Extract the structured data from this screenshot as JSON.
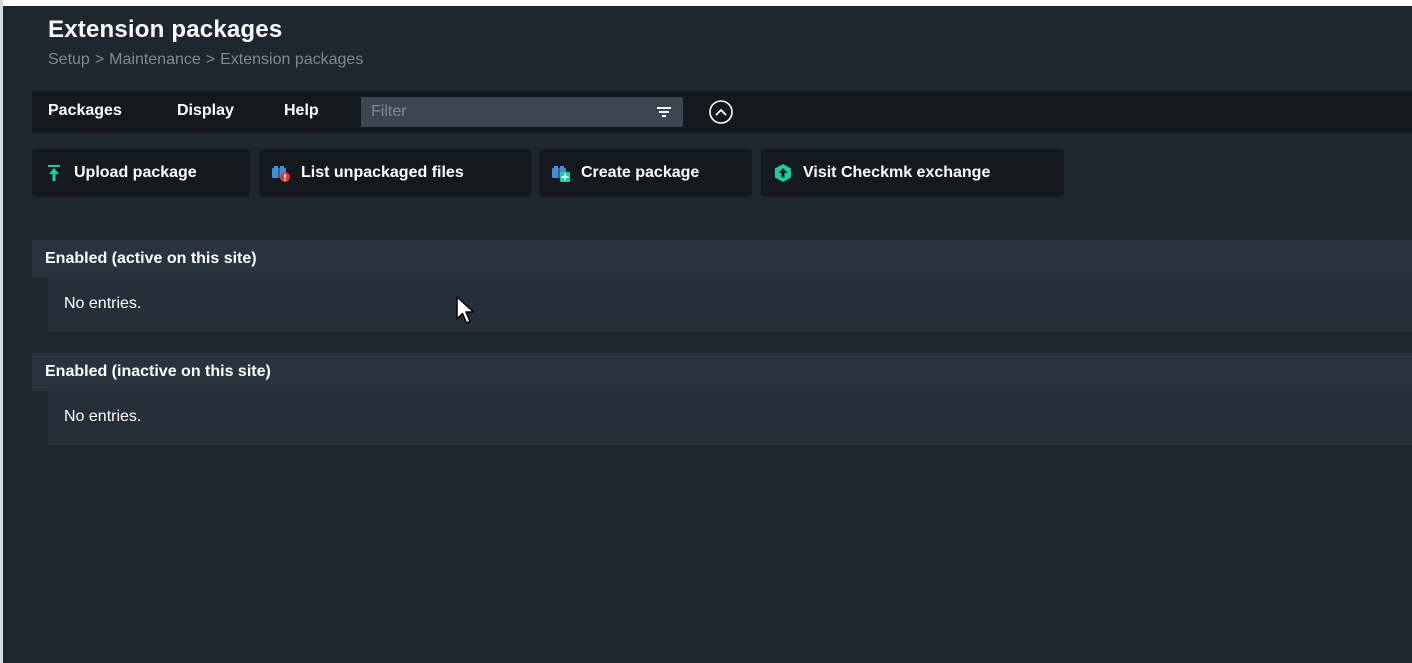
{
  "page": {
    "title": "Extension packages",
    "breadcrumb": [
      "Setup",
      "Maintenance",
      "Extension packages"
    ],
    "breadcrumb_separator": ">"
  },
  "menubar": {
    "items": [
      "Packages",
      "Display",
      "Help"
    ],
    "filter_placeholder": "Filter",
    "filter_value": "",
    "filter_icon": "filter-icon",
    "collapse_icon": "chevron-up-circle-icon"
  },
  "actions": [
    {
      "label": "Upload package",
      "icon": "upload-icon"
    },
    {
      "label": "List unpackaged files",
      "icon": "unpackaged-files-icon"
    },
    {
      "label": "Create package",
      "icon": "create-package-icon"
    },
    {
      "label": "Visit Checkmk exchange",
      "icon": "checkmk-exchange-icon"
    }
  ],
  "sections": [
    {
      "title": "Enabled (active on this site)",
      "empty_text": "No entries."
    },
    {
      "title": "Enabled (inactive on this site)",
      "empty_text": "No entries."
    }
  ],
  "colors": {
    "background": "#1e262e",
    "menubar": "#13191f",
    "section_header": "#2a333d",
    "accent_green": "#15d1a0",
    "icon_blue": "#3f8fdb",
    "icon_red": "#e53935"
  }
}
